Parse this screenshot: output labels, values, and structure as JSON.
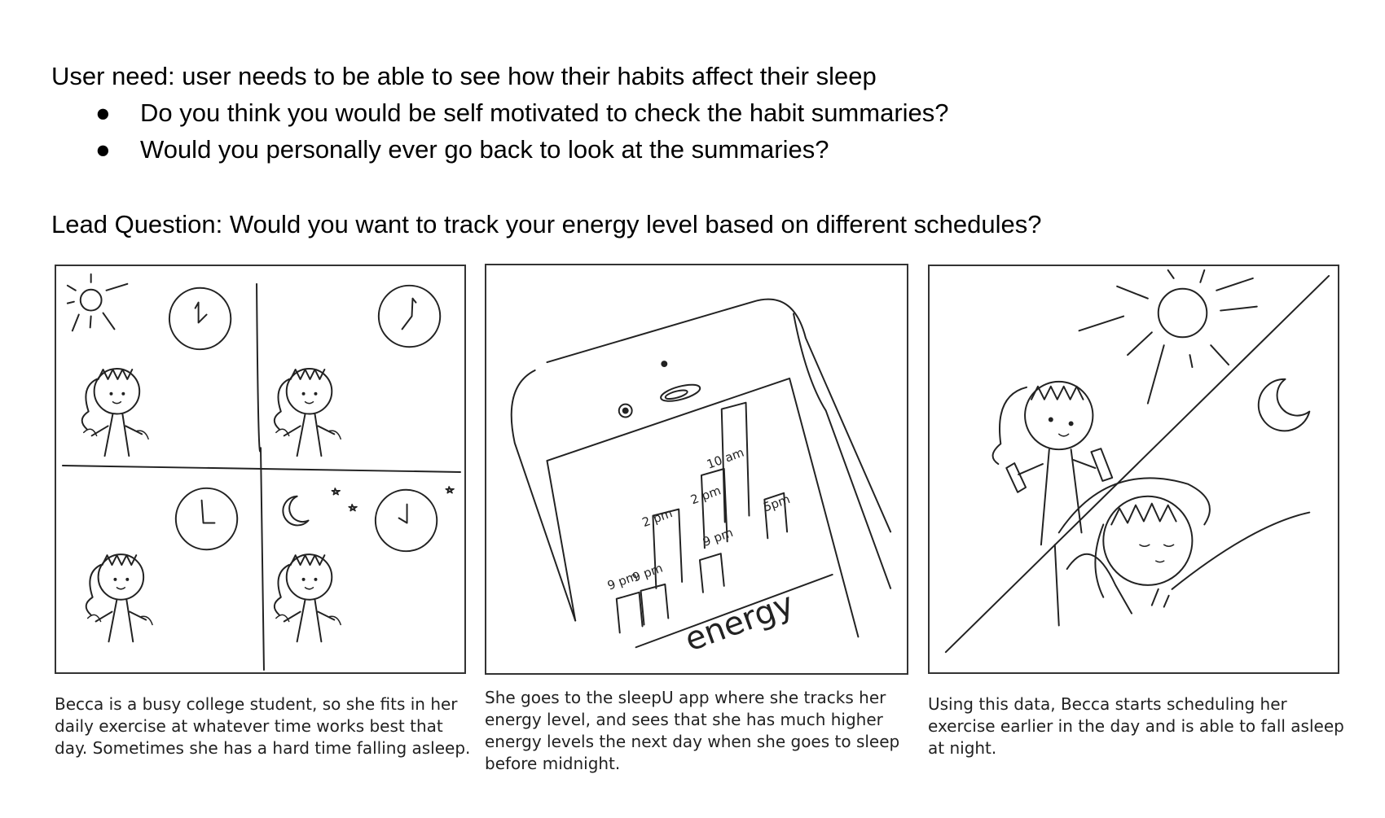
{
  "user_need": "User need: user needs to be able to see how their habits affect their sleep",
  "bullets": [
    "Do you think you would be self motivated to check the habit summaries?",
    "Would you personally ever go back to look at the summaries?"
  ],
  "bullet_symbol": "●",
  "lead_question": "Lead Question: Would you want to track your energy level based on different schedules?",
  "panels": [
    {
      "caption": "Becca is a busy college student, so she fits in her daily exercise at whatever time works best that day. Sometimes she has a hard time falling asleep."
    },
    {
      "caption": "She goes to the sleepU app where she tracks her energy level, and sees that she has much higher energy levels the next day when she goes to sleep before midnight.",
      "phone_chart": {
        "bar_labels": [
          "9 pm",
          "9 pm",
          "2 pm",
          "9 pm",
          "2 pm",
          "10 am",
          "5pm"
        ],
        "axis_label": "energy"
      }
    },
    {
      "caption": "Using this data, Becca starts scheduling her exercise earlier in the day and is able to fall asleep at night."
    }
  ]
}
